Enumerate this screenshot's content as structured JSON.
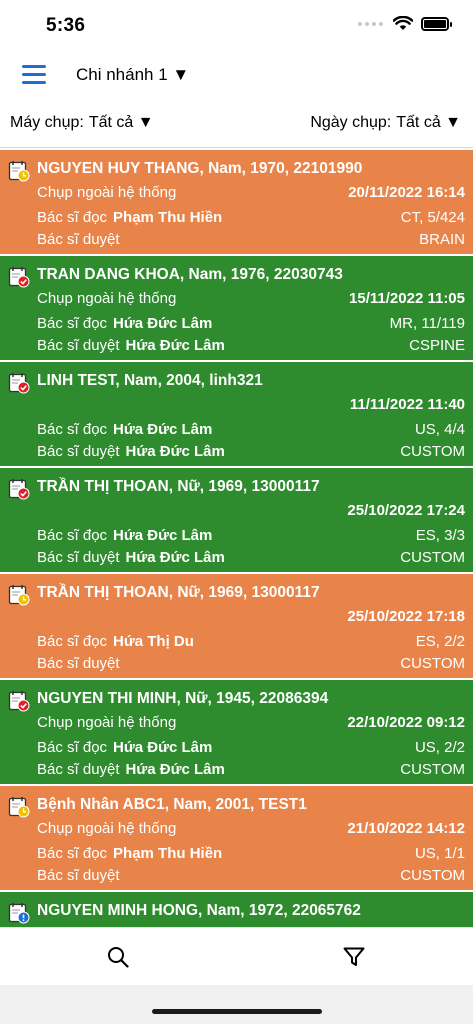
{
  "status_bar": {
    "time": "5:36"
  },
  "header": {
    "branch": "Chi nhánh 1 ▼"
  },
  "filters": {
    "device_label": "Máy chụp:",
    "device_value": "Tất cả ▼",
    "date_label": "Ngày chụp:",
    "date_value": "Tất cả ▼"
  },
  "colors": {
    "orange": "#e8844a",
    "green": "#2e8b2e",
    "accent": "#1e6fd0"
  },
  "labels": {
    "read_doctor": "Bác sĩ đọc",
    "approve_doctor": "Bác sĩ duyệt"
  },
  "studies": [
    {
      "title": "NGUYEN HUY THANG, Nam, 1970, 22101990",
      "source": "Chụp ngoài hệ thống",
      "datetime": "20/11/2022 16:14",
      "read_doctor": "Phạm Thu Hiền",
      "modality": "CT, 5/424",
      "approve_doctor": "",
      "type": "BRAIN",
      "color": "orange",
      "icon": "pending-clock-icon"
    },
    {
      "title": "TRAN DANG KHOA, Nam, 1976, 22030743",
      "source": "Chụp ngoài hệ thống",
      "datetime": "15/11/2022 11:05",
      "read_doctor": "Hứa Đức Lâm",
      "modality": "MR, 11/119",
      "approve_doctor": "Hứa Đức Lâm",
      "type": "CSPINE",
      "color": "green",
      "icon": "approved-check-icon"
    },
    {
      "title": "LINH TEST, Nam, 2004, linh321",
      "source": "",
      "datetime": "11/11/2022 11:40",
      "read_doctor": "Hứa Đức Lâm",
      "modality": "US, 4/4",
      "approve_doctor": "Hứa Đức Lâm",
      "type": "CUSTOM",
      "color": "green",
      "icon": "approved-check-icon"
    },
    {
      "title": "TRẦN THỊ THOAN, Nữ, 1969, 13000117",
      "source": "",
      "datetime": "25/10/2022 17:24",
      "read_doctor": "Hứa Đức Lâm",
      "modality": "ES, 3/3",
      "approve_doctor": "Hứa Đức Lâm",
      "type": "CUSTOM",
      "color": "green",
      "icon": "approved-check-icon"
    },
    {
      "title": "TRẦN THỊ THOAN, Nữ, 1969, 13000117",
      "source": "",
      "datetime": "25/10/2022 17:18",
      "read_doctor": "Hứa Thị Du",
      "modality": "ES, 2/2",
      "approve_doctor": "",
      "type": "CUSTOM",
      "color": "orange",
      "icon": "pending-clock-icon"
    },
    {
      "title": "NGUYEN THI MINH, Nữ, 1945, 22086394",
      "source": "Chụp ngoài hệ thống",
      "datetime": "22/10/2022 09:12",
      "read_doctor": "Hứa Đức Lâm",
      "modality": "US, 2/2",
      "approve_doctor": "Hứa Đức Lâm",
      "type": "CUSTOM",
      "color": "green",
      "icon": "approved-check-icon"
    },
    {
      "title": "Bệnh Nhân ABC1, Nam, 2001, TEST1",
      "source": "Chụp ngoài hệ thống",
      "datetime": "21/10/2022 14:12",
      "read_doctor": "Phạm Thu Hiền",
      "modality": "US, 1/1",
      "approve_doctor": "",
      "type": "CUSTOM",
      "color": "orange",
      "icon": "pending-clock-icon"
    },
    {
      "title": "NGUYEN MINH HONG, Nam, 1972, 22065762",
      "source": "",
      "datetime": "",
      "read_doctor": "",
      "modality": "",
      "approve_doctor": "",
      "type": "",
      "color": "green",
      "icon": "unread-alert-icon"
    }
  ]
}
